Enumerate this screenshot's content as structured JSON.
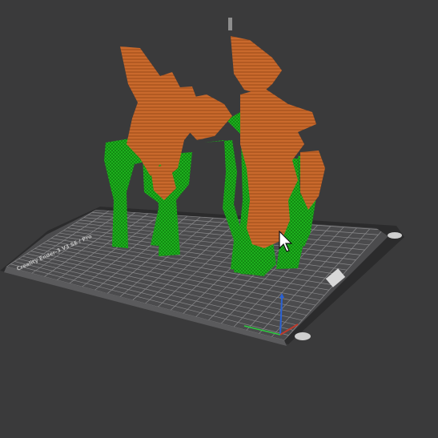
{
  "app": {
    "view": "3d-slice-preview"
  },
  "plate": {
    "label_left": "Creality Ender-3 V3 SE / Pro",
    "label_right": "",
    "grid": true
  },
  "model": {
    "parts": [
      {
        "name": "object",
        "color": "#c9692c"
      },
      {
        "name": "support",
        "color": "#1fb81f"
      }
    ]
  },
  "axes": {
    "x_color": "#c0392b",
    "y_color": "#2ecc40",
    "z_color": "#2a62d6"
  },
  "colors": {
    "background": "#3a3a3b",
    "plate": "#4b4b4d",
    "plate_edge": "#2b2b2c",
    "grid": "#8a8a8c",
    "object_orange": "#c9692c",
    "support_green": "#1fb81f"
  },
  "icons": [
    "cursor-arrow-icon",
    "plate-logo-icon"
  ]
}
